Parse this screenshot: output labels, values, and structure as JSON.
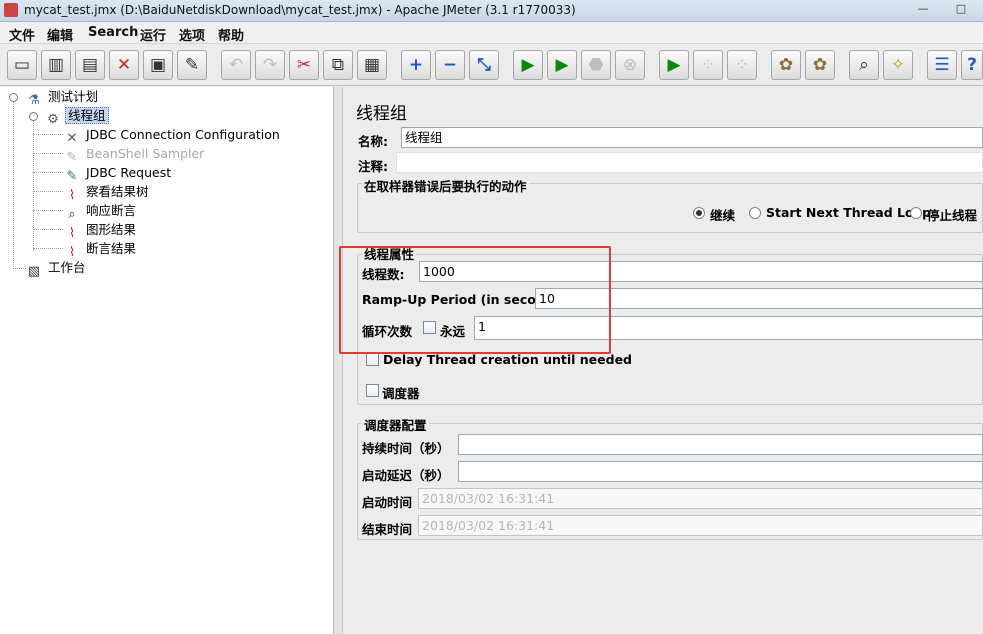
{
  "window": {
    "title": "mycat_test.jmx (D:\\BaiduNetdiskDownload\\mycat_test.jmx) - Apache JMeter (3.1 r1770033)",
    "minimize": "—",
    "maximize": "□"
  },
  "menu": [
    "文件",
    "编辑",
    "Search",
    "运行",
    "选项",
    "帮助"
  ],
  "toolbar": [
    {
      "icon": "new-icon",
      "glyph": "▭"
    },
    {
      "icon": "templates-icon",
      "glyph": "▥"
    },
    {
      "icon": "open-icon",
      "glyph": "▤"
    },
    {
      "icon": "close-icon",
      "glyph": "✕"
    },
    {
      "icon": "save-icon",
      "glyph": "▣"
    },
    {
      "icon": "save-as-icon",
      "glyph": "✎"
    },
    {
      "icon": "undo-icon",
      "glyph": "↶"
    },
    {
      "icon": "redo-icon",
      "glyph": "↷"
    },
    {
      "icon": "cut-icon",
      "glyph": "✂"
    },
    {
      "icon": "copy-icon",
      "glyph": "⧉"
    },
    {
      "icon": "paste-icon",
      "glyph": "▦"
    },
    {
      "icon": "expand-icon",
      "glyph": "+"
    },
    {
      "icon": "collapse-icon",
      "glyph": "−"
    },
    {
      "icon": "toggle-icon",
      "glyph": "⤡"
    },
    {
      "icon": "start-icon",
      "glyph": "▶"
    },
    {
      "icon": "start-no-pause-icon",
      "glyph": "▶"
    },
    {
      "icon": "stop-icon",
      "glyph": "⬣"
    },
    {
      "icon": "shutdown-icon",
      "glyph": "⊗"
    },
    {
      "icon": "remote-start-icon",
      "glyph": "▶"
    },
    {
      "icon": "remote-stop-icon",
      "glyph": "⁘"
    },
    {
      "icon": "remote-shutdown-icon",
      "glyph": "⁘"
    },
    {
      "icon": "clear-icon",
      "glyph": "✿"
    },
    {
      "icon": "clear-all-icon",
      "glyph": "✿"
    },
    {
      "icon": "search-icon",
      "glyph": "⌕"
    },
    {
      "icon": "reset-search-icon",
      "glyph": "✧"
    },
    {
      "icon": "function-helper-icon",
      "glyph": "☰"
    },
    {
      "icon": "help-icon",
      "glyph": "?"
    }
  ],
  "tree": {
    "root": "测试计划",
    "thread_group": "线程组",
    "children": [
      {
        "label": "JDBC Connection Configuration",
        "icon": "wrench-icon",
        "glyph": "✕",
        "disabled": false
      },
      {
        "label": "BeanShell Sampler",
        "icon": "pen-icon",
        "glyph": "✎",
        "disabled": true
      },
      {
        "label": "JDBC Request",
        "icon": "pen-icon",
        "glyph": "✎",
        "disabled": false
      },
      {
        "label": "察看结果树",
        "icon": "chart-icon",
        "glyph": "⌇",
        "disabled": false
      },
      {
        "label": "响应断言",
        "icon": "magnifier-icon",
        "glyph": "⌕",
        "disabled": false
      },
      {
        "label": "图形结果",
        "icon": "chart-icon",
        "glyph": "⌇",
        "disabled": false
      },
      {
        "label": "断言结果",
        "icon": "chart-icon",
        "glyph": "⌇",
        "disabled": false
      }
    ],
    "workbench": "工作台"
  },
  "panel": {
    "title": "线程组",
    "name_label": "名称:",
    "name_value": "线程组",
    "comment_label": "注释:",
    "comment_value": "",
    "error_action": {
      "legend": "在取样器错误后要执行的动作",
      "options": [
        "继续",
        "Start Next Thread Loop",
        "停止线程"
      ],
      "selected": "继续"
    },
    "thread_props": {
      "legend": "线程属性",
      "threads_label": "线程数:",
      "threads_value": "1000",
      "rampup_label": "Ramp-Up Period (in seconds):",
      "rampup_value": "10",
      "loop_label": "循环次数",
      "forever_label": "永远",
      "forever_checked": false,
      "loop_value": "1",
      "delay_label": "Delay Thread creation until needed",
      "delay_checked": false,
      "scheduler_label": "调度器",
      "scheduler_checked": false
    },
    "scheduler_config": {
      "legend": "调度器配置",
      "duration_label": "持续时间（秒）",
      "duration_value": "",
      "delay_label": "启动延迟（秒）",
      "delay_value": "",
      "start_label": "启动时间",
      "start_value": "2018/03/02 16:31:41",
      "end_label": "结束时间",
      "end_value": "2018/03/02 16:31:41"
    },
    "highlight_color": "#e53935"
  }
}
